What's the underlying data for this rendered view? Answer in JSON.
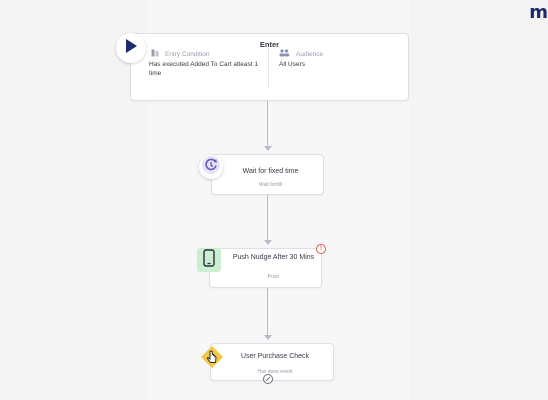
{
  "brand": {
    "logo_fragment": "m"
  },
  "entry": {
    "title": "Enter",
    "condition_label": "Entry Condition",
    "condition_text": "Has executed Added To Cart atleast 1 time",
    "audience_label": "Audience",
    "audience_text": "All Users"
  },
  "wait": {
    "title": "Wait for fixed time",
    "subtitle": "Wait for/till"
  },
  "push": {
    "title": "Push Nudge After 30 Mins",
    "subtitle": "Push",
    "warning": "!"
  },
  "condition": {
    "title": "User Purchase Check",
    "subtitle": "Has done event"
  },
  "colors": {
    "play_icon": "#1d2a6b",
    "wait_icon_bg": "#e7e2f6",
    "wait_icon": "#6a5cb8",
    "push_icon_bg": "#c9efd0",
    "condition_icon": "#f2c744",
    "warning": "#e25b45",
    "connector": "#b8bcc9"
  },
  "icons": {
    "start": "play-icon",
    "entry_condition": "filter-icon",
    "audience": "users-icon",
    "wait": "clock-refresh-icon",
    "push": "phone-icon",
    "condition": "hand-pointer-icon",
    "add_step": "add-step-icon"
  }
}
